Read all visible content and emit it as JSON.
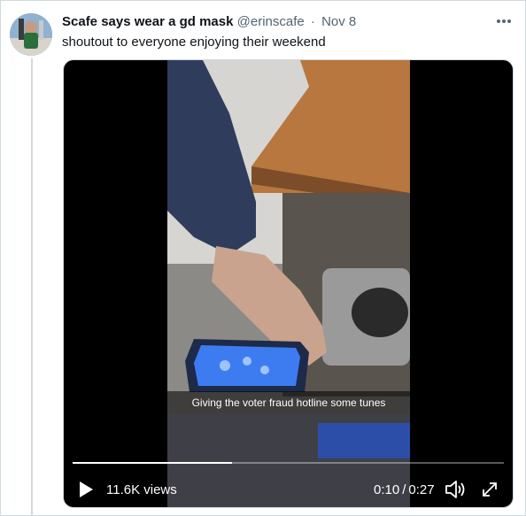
{
  "tweet": {
    "author_name": "Scafe says wear a gd mask",
    "handle": "@erinscafe",
    "separator": "·",
    "date": "Nov 8",
    "text": "shoutout to everyone enjoying their weekend"
  },
  "video": {
    "caption": "Giving the voter fraud hotline some tunes",
    "views": "11.6K views",
    "time_current": "0:10",
    "time_separator": "/",
    "time_total": "0:27",
    "progress_fraction": 0.37
  },
  "icons": {
    "more": "more-horizontal-icon",
    "play": "play-icon",
    "volume": "volume-icon",
    "fullscreen": "fullscreen-icon"
  },
  "colors": {
    "text_primary": "#0f1419",
    "text_secondary": "#536471",
    "border": "#cfd9de",
    "video_bg": "#000000"
  }
}
